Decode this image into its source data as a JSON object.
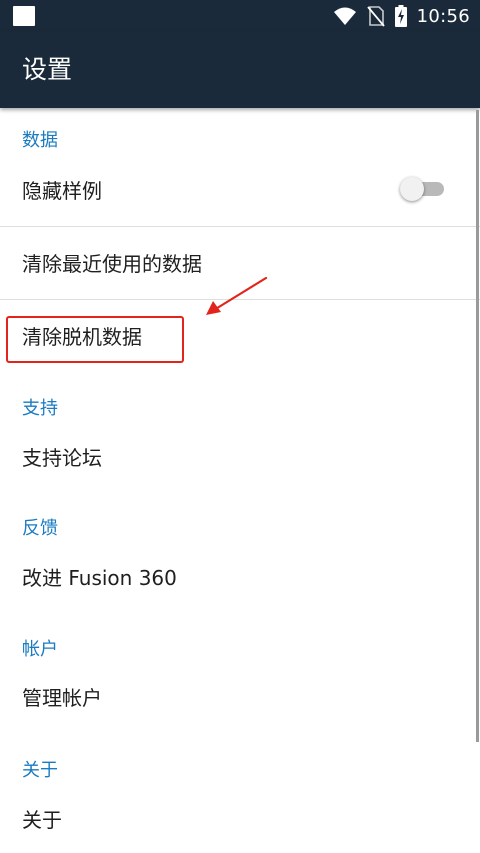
{
  "status_bar": {
    "time": "10:56",
    "icons": [
      "wifi-icon",
      "no-sim-icon",
      "battery-charging-icon"
    ]
  },
  "app_bar": {
    "title": "设置"
  },
  "sections": {
    "data": {
      "header": "数据",
      "hide_samples": {
        "label": "隐藏样例",
        "switch_on": false
      },
      "clear_recent": "清除最近使用的数据",
      "clear_offline": "清除脱机数据"
    },
    "support": {
      "header": "支持",
      "forum": "支持论坛"
    },
    "feedback": {
      "header": "反馈",
      "improve": "改进 Fusion 360"
    },
    "account": {
      "header": "帐户",
      "manage": "管理帐户"
    },
    "about": {
      "header": "关于",
      "about": "关于"
    }
  },
  "annotation": {
    "color": "#e2241c"
  },
  "colors": {
    "app_bar": "#1b2a3a",
    "section_header": "#1a7bc1"
  }
}
